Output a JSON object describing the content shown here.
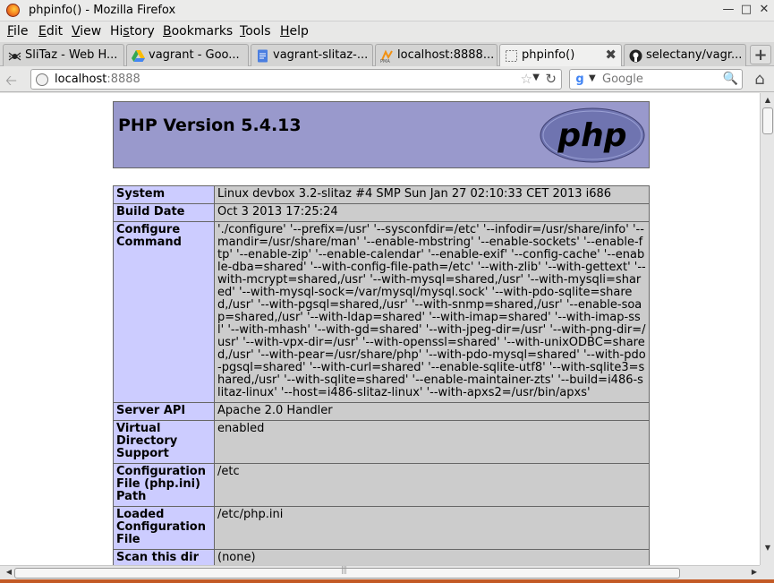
{
  "window": {
    "title": "phpinfo() - Mozilla Firefox"
  },
  "menu": [
    {
      "label": "File",
      "u": "F",
      "rest": "ile"
    },
    {
      "label": "Edit",
      "u": "E",
      "rest": "dit"
    },
    {
      "label": "View",
      "u": "V",
      "rest": "iew"
    },
    {
      "label": "History",
      "pre": "Hi",
      "u": "s",
      "rest": "tory"
    },
    {
      "label": "Bookmarks",
      "u": "B",
      "rest": "ookmarks"
    },
    {
      "label": "Tools",
      "u": "T",
      "rest": "ools"
    },
    {
      "label": "Help",
      "u": "H",
      "rest": "elp"
    }
  ],
  "tabs": [
    {
      "label": "SliTaz - Web H...",
      "icon": "spider-icon",
      "active": false
    },
    {
      "label": "vagrant - Goo...",
      "icon": "google-drive-icon",
      "active": false
    },
    {
      "label": "vagrant-slitaz-...",
      "icon": "document-icon",
      "active": false
    },
    {
      "label": "localhost:8888...",
      "icon": "phpmyadmin-icon",
      "active": false
    },
    {
      "label": "phpinfo()",
      "icon": "blank-page-icon",
      "active": true
    },
    {
      "label": "selectany/vagr...",
      "icon": "github-icon",
      "active": false
    }
  ],
  "nav": {
    "url_host": "localhost",
    "url_port": ":8888",
    "search_placeholder": "Google"
  },
  "php": {
    "version_title": "PHP Version 5.4.13",
    "logo_text": "php",
    "rows": [
      {
        "key": "System",
        "value": "Linux devbox 3.2-slitaz #4 SMP Sun Jan 27 02:10:33 CET 2013 i686"
      },
      {
        "key": "Build Date",
        "value": "Oct 3 2013 17:25:24"
      },
      {
        "key": "Configure Command",
        "value": "'./configure' '--prefix=/usr' '--sysconfdir=/etc' '--infodir=/usr/share/info' '--mandir=/usr/share/man' '--enable-mbstring' '--enable-sockets' '--enable-ftp' '--enable-zip' '--enable-calendar' '--enable-exif' '--config-cache' '--enable-dba=shared' '--with-config-file-path=/etc' '--with-zlib' '--with-gettext' '--with-mcrypt=shared,/usr' '--with-mysql=shared,/usr' '--with-mysqli=shared' '--with-mysql-sock=/var/mysql/mysql.sock' '--with-pdo-sqlite=shared,/usr' '--with-pgsql=shared,/usr' '--with-snmp=shared,/usr' '--enable-soap=shared,/usr' '--with-ldap=shared' '--with-imap=shared' '--with-imap-ssl' '--with-mhash' '--with-gd=shared' '--with-jpeg-dir=/usr' '--with-png-dir=/usr' '--with-vpx-dir=/usr' '--with-openssl=shared' '--with-unixODBC=shared,/usr' '--with-pear=/usr/share/php' '--with-pdo-mysql=shared' '--with-pdo-pgsql=shared' '--with-curl=shared' '--enable-sqlite-utf8' '--with-sqlite3=shared,/usr' '--with-sqlite=shared' '--enable-maintainer-zts' '--build=i486-slitaz-linux' '--host=i486-slitaz-linux' '--with-apxs2=/usr/bin/apxs'"
      },
      {
        "key": "Server API",
        "value": "Apache 2.0 Handler"
      },
      {
        "key": "Virtual Directory Support",
        "value": "enabled"
      },
      {
        "key": "Configuration File (php.ini) Path",
        "value": "/etc"
      },
      {
        "key": "Loaded Configuration File",
        "value": "/etc/php.ini"
      },
      {
        "key": "Scan this dir",
        "value": "(none)"
      }
    ]
  }
}
